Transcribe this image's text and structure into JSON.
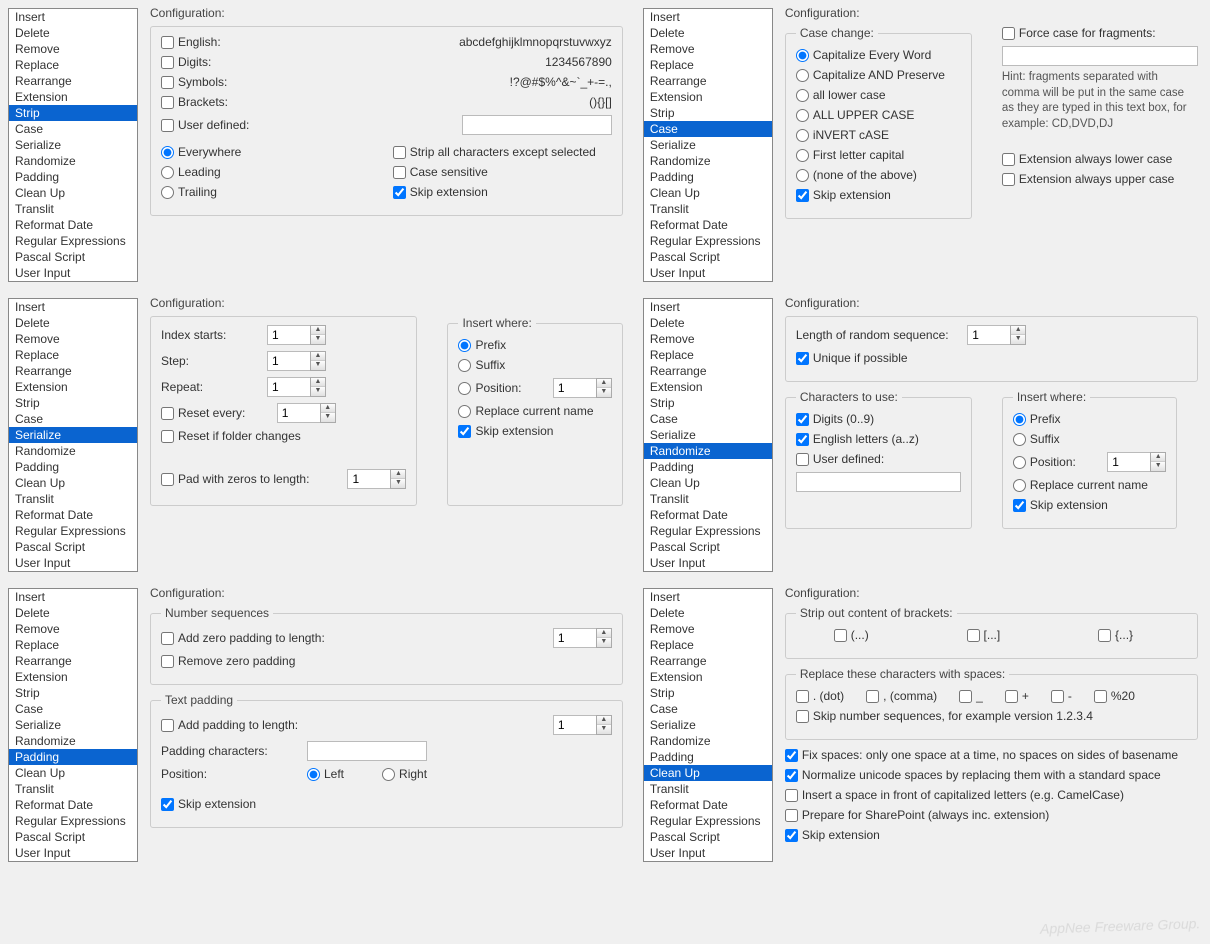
{
  "listItems": [
    "Insert",
    "Delete",
    "Remove",
    "Replace",
    "Rearrange",
    "Extension",
    "Strip",
    "Case",
    "Serialize",
    "Randomize",
    "Padding",
    "Clean Up",
    "Translit",
    "Reformat Date",
    "Regular Expressions",
    "Pascal Script",
    "User Input"
  ],
  "configLabel": "Configuration:",
  "panels": {
    "strip": {
      "selected": "Strip",
      "english": "English:",
      "englishVal": "abcdefghijklmnopqrstuvwxyz",
      "digits": "Digits:",
      "digitsVal": "1234567890",
      "symbols": "Symbols:",
      "symbolsVal": "!?@#$%^&~`_+-=.,",
      "brackets": "Brackets:",
      "bracketsVal": "(){}[]",
      "userdef": "User defined:",
      "everywhere": "Everywhere",
      "leading": "Leading",
      "trailing": "Trailing",
      "stripExcept": "Strip all characters except selected",
      "caseSensitive": "Case sensitive",
      "skipExt": "Skip extension"
    },
    "case": {
      "selected": "Case",
      "caseChange": "Case change:",
      "opt1": "Capitalize Every Word",
      "opt2": "Capitalize AND Preserve",
      "opt3": "all lower case",
      "opt4": "ALL UPPER CASE",
      "opt5": "iNVERT cASE",
      "opt6": "First letter capital",
      "opt7": "(none of the above)",
      "skipExt": "Skip extension",
      "forceCase": "Force case for fragments:",
      "hint": "Hint: fragments separated with comma will be put in the same case as they are typed in this text box, for example: CD,DVD,DJ",
      "extLower": "Extension always lower case",
      "extUpper": "Extension always upper case"
    },
    "serialize": {
      "selected": "Serialize",
      "indexStarts": "Index starts:",
      "indexVal": "1",
      "step": "Step:",
      "stepVal": "1",
      "repeat": "Repeat:",
      "repeatVal": "1",
      "resetEvery": "Reset every:",
      "resetVal": "1",
      "resetFolder": "Reset if folder changes",
      "padZeros": "Pad with zeros to length:",
      "padVal": "1",
      "insertWhere": "Insert where:",
      "prefix": "Prefix",
      "suffix": "Suffix",
      "position": "Position:",
      "posVal": "1",
      "replaceCurrent": "Replace current name",
      "skipExt": "Skip extension"
    },
    "randomize": {
      "selected": "Randomize",
      "lenLabel": "Length of random sequence:",
      "lenVal": "1",
      "unique": "Unique if possible",
      "charsToUse": "Characters to use:",
      "digitsOpt": "Digits (0..9)",
      "lettersOpt": "English letters (a..z)",
      "userDefOpt": "User defined:",
      "insertWhere": "Insert where:",
      "prefix": "Prefix",
      "suffix": "Suffix",
      "position": "Position:",
      "posVal": "1",
      "replaceCurrent": "Replace current name",
      "skipExt": "Skip extension"
    },
    "padding": {
      "selected": "Padding",
      "numSeq": "Number sequences",
      "addZero": "Add zero padding to length:",
      "addZeroVal": "1",
      "removeZero": "Remove zero padding",
      "textPad": "Text padding",
      "addPad": "Add padding to length:",
      "addPadVal": "1",
      "padChars": "Padding characters:",
      "position": "Position:",
      "left": "Left",
      "right": "Right",
      "skipExt": "Skip extension"
    },
    "cleanup": {
      "selected": "Clean Up",
      "stripBrackets": "Strip out content of brackets:",
      "paren": "(...)",
      "square": "[...]",
      "curly": "{...}",
      "replaceSpaces": "Replace these characters with spaces:",
      "dot": ". (dot)",
      "comma": ", (comma)",
      "underscore": "_",
      "plus": "+",
      "dash": "-",
      "pct20": "%20",
      "skipNum": "Skip number sequences, for example version 1.2.3.4",
      "fixSpaces": "Fix spaces: only one space at a time, no spaces on sides of basename",
      "normUnicode": "Normalize unicode spaces by replacing them with a standard space",
      "insertSpace": "Insert a space in front of capitalized letters (e.g. CamelCase)",
      "sharePoint": "Prepare for SharePoint (always inc. extension)",
      "skipExt": "Skip extension"
    }
  },
  "watermark": "AppNee Freeware Group."
}
